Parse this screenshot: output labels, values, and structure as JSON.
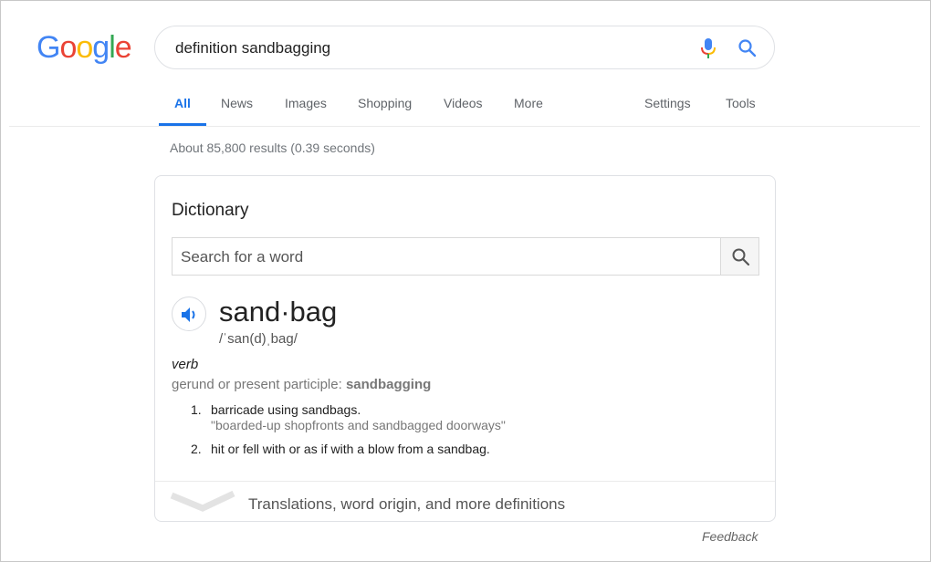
{
  "logo": {
    "letters": [
      "G",
      "o",
      "o",
      "g",
      "l",
      "e"
    ],
    "colors": [
      "#4285f4",
      "#ea4335",
      "#fbbc05",
      "#4285f4",
      "#34a853",
      "#ea4335"
    ]
  },
  "search": {
    "query": "definition sandbagging",
    "mic_icon": "microphone-icon",
    "search_icon": "search-icon"
  },
  "tabs": {
    "items": [
      {
        "label": "All",
        "active": true
      },
      {
        "label": "News"
      },
      {
        "label": "Images"
      },
      {
        "label": "Shopping"
      },
      {
        "label": "Videos"
      },
      {
        "label": "More"
      }
    ],
    "settings": "Settings",
    "tools": "Tools",
    "accent": "#1a73e8"
  },
  "stats": "About 85,800 results (0.39 seconds)",
  "dictionary": {
    "title": "Dictionary",
    "search_placeholder": "Search for a word",
    "word": "sand·bag",
    "phonetic": "/ˈsan(d)ˌbag/",
    "part_of_speech": "verb",
    "gerund_label": "gerund or present participle: ",
    "gerund_value": "sandbagging",
    "definitions": [
      {
        "num": "1.",
        "text": "barricade using sandbags.",
        "example": "\"boarded-up shopfronts and sandbagged doorways\""
      },
      {
        "num": "2.",
        "text": "hit or fell with or as if with a blow from a sandbag."
      }
    ],
    "more_label": "Translations, word origin, and more definitions"
  },
  "feedback": "Feedback"
}
